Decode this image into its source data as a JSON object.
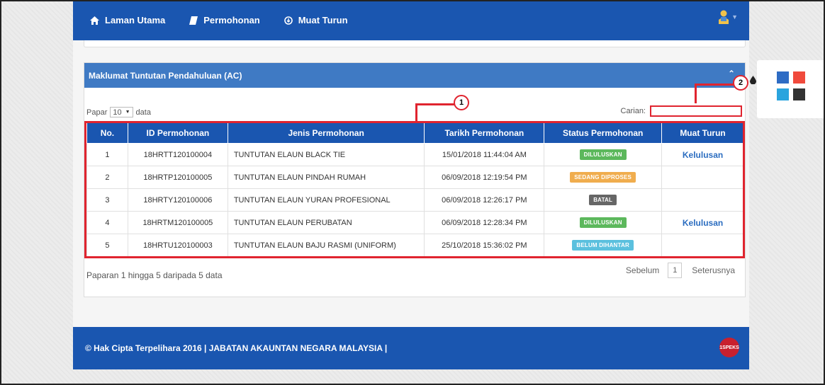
{
  "nav": {
    "home": "Laman Utama",
    "application": "Permohonan",
    "download": "Muat Turun"
  },
  "panel": {
    "title": "Maklumat Tuntutan Pendahuluan (AC)"
  },
  "length": {
    "prefix": "Papar",
    "value": "10",
    "suffix": "data"
  },
  "search": {
    "label": "Carian:",
    "value": ""
  },
  "table": {
    "headers": [
      "No.",
      "ID Permohonan",
      "Jenis Permohonan",
      "Tarikh Permohonan",
      "Status Permohonan",
      "Muat Turun"
    ],
    "rows": [
      {
        "no": "1",
        "id": "18HRTT120100004",
        "type": "TUNTUTAN ELAUN BLACK TIE",
        "date": "15/01/2018 11:44:04 AM",
        "status": "DILULUSKAN",
        "status_color": "#5cb85c",
        "download": "Kelulusan"
      },
      {
        "no": "2",
        "id": "18HRTP120100005",
        "type": "TUNTUTAN ELAUN PINDAH RUMAH",
        "date": "06/09/2018 12:19:54 PM",
        "status": "SEDANG DIPROSES",
        "status_color": "#f0ad4e",
        "download": ""
      },
      {
        "no": "3",
        "id": "18HRTY120100006",
        "type": "TUNTUTAN ELAUN YURAN PROFESIONAL",
        "date": "06/09/2018 12:26:17 PM",
        "status": "BATAL",
        "status_color": "#666666",
        "download": ""
      },
      {
        "no": "4",
        "id": "18HRTM120100005",
        "type": "TUNTUTAN ELAUN PERUBATAN",
        "date": "06/09/2018 12:28:34 PM",
        "status": "DILULUSKAN",
        "status_color": "#5cb85c",
        "download": "Kelulusan"
      },
      {
        "no": "5",
        "id": "18HRTU120100003",
        "type": "TUNTUTAN ELAUN BAJU RASMI (UNIFORM)",
        "date": "25/10/2018 15:36:02 PM",
        "status": "BELUM DIHANTAR",
        "status_color": "#5bc0de",
        "download": ""
      }
    ]
  },
  "info": "Paparan 1 hingga 5 daripada 5 data",
  "pager": {
    "prev": "Sebelum",
    "page": "1",
    "next": "Seterusnya"
  },
  "callouts": {
    "one": "1",
    "two": "2"
  },
  "footer": {
    "text": "© Hak Cipta Terpelihara 2016 | JABATAN AKAUNTAN NEGARA MALAYSIA |",
    "logo": "1SPEKS"
  },
  "theme": {
    "swatches": [
      "#2e6cc4",
      "#f04a3c",
      "#2aa4de",
      "#333333"
    ]
  },
  "colors": {
    "primary": "#1a56b0",
    "panel_heading": "#3f7ac4",
    "highlight": "#e0242f"
  }
}
